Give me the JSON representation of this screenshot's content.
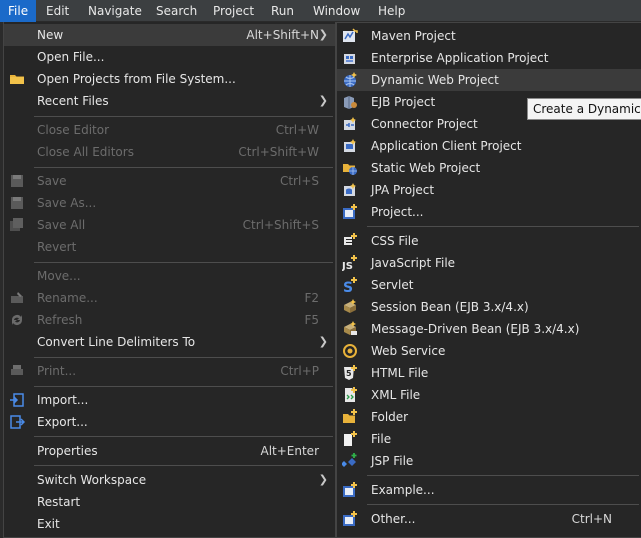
{
  "menubar": [
    "File",
    "Edit",
    "Navigate",
    "Search",
    "Project",
    "Run",
    "Window",
    "Help"
  ],
  "file_menu": {
    "new": {
      "label": "New",
      "shortcut": "Alt+Shift+N"
    },
    "open_file": {
      "label": "Open File..."
    },
    "open_projects": {
      "label": "Open Projects from File System..."
    },
    "recent_files": {
      "label": "Recent Files"
    },
    "close_editor": {
      "label": "Close Editor",
      "shortcut": "Ctrl+W"
    },
    "close_all_editors": {
      "label": "Close All Editors",
      "shortcut": "Ctrl+Shift+W"
    },
    "save": {
      "label": "Save",
      "shortcut": "Ctrl+S"
    },
    "save_as": {
      "label": "Save As..."
    },
    "save_all": {
      "label": "Save All",
      "shortcut": "Ctrl+Shift+S"
    },
    "revert": {
      "label": "Revert"
    },
    "move": {
      "label": "Move..."
    },
    "rename": {
      "label": "Rename...",
      "shortcut": "F2"
    },
    "refresh": {
      "label": "Refresh",
      "shortcut": "F5"
    },
    "convert_line_delimiters": {
      "label": "Convert Line Delimiters To"
    },
    "print": {
      "label": "Print...",
      "shortcut": "Ctrl+P"
    },
    "import": {
      "label": "Import..."
    },
    "export": {
      "label": "Export..."
    },
    "properties": {
      "label": "Properties",
      "shortcut": "Alt+Enter"
    },
    "switch_workspace": {
      "label": "Switch Workspace"
    },
    "restart": {
      "label": "Restart"
    },
    "exit": {
      "label": "Exit"
    }
  },
  "new_menu": {
    "maven_project": "Maven Project",
    "enterprise_app_project": "Enterprise Application Project",
    "dynamic_web_project": "Dynamic Web Project",
    "ejb_project": "EJB Project",
    "connector_project": "Connector Project",
    "app_client_project": "Application Client Project",
    "static_web_project": "Static Web Project",
    "jpa_project": "JPA Project",
    "project": "Project...",
    "css_file": "CSS File",
    "javascript_file": "JavaScript File",
    "servlet": "Servlet",
    "session_bean": "Session Bean (EJB 3.x/4.x)",
    "message_driven_bean": "Message-Driven Bean (EJB 3.x/4.x)",
    "web_service": "Web Service",
    "html_file": "HTML File",
    "xml_file": "XML File",
    "folder": "Folder",
    "file": "File",
    "jsp_file": "JSP File",
    "example": "Example...",
    "other": {
      "label": "Other...",
      "shortcut": "Ctrl+N"
    }
  },
  "tooltip": "Create a Dynamic W",
  "colors": {
    "menubar_bg": "#3c3f41",
    "active_menu": "#1b6ac9",
    "menu_bg": "#262626",
    "highlight": "#3b3b3b",
    "disabled": "#6c6c6c"
  }
}
